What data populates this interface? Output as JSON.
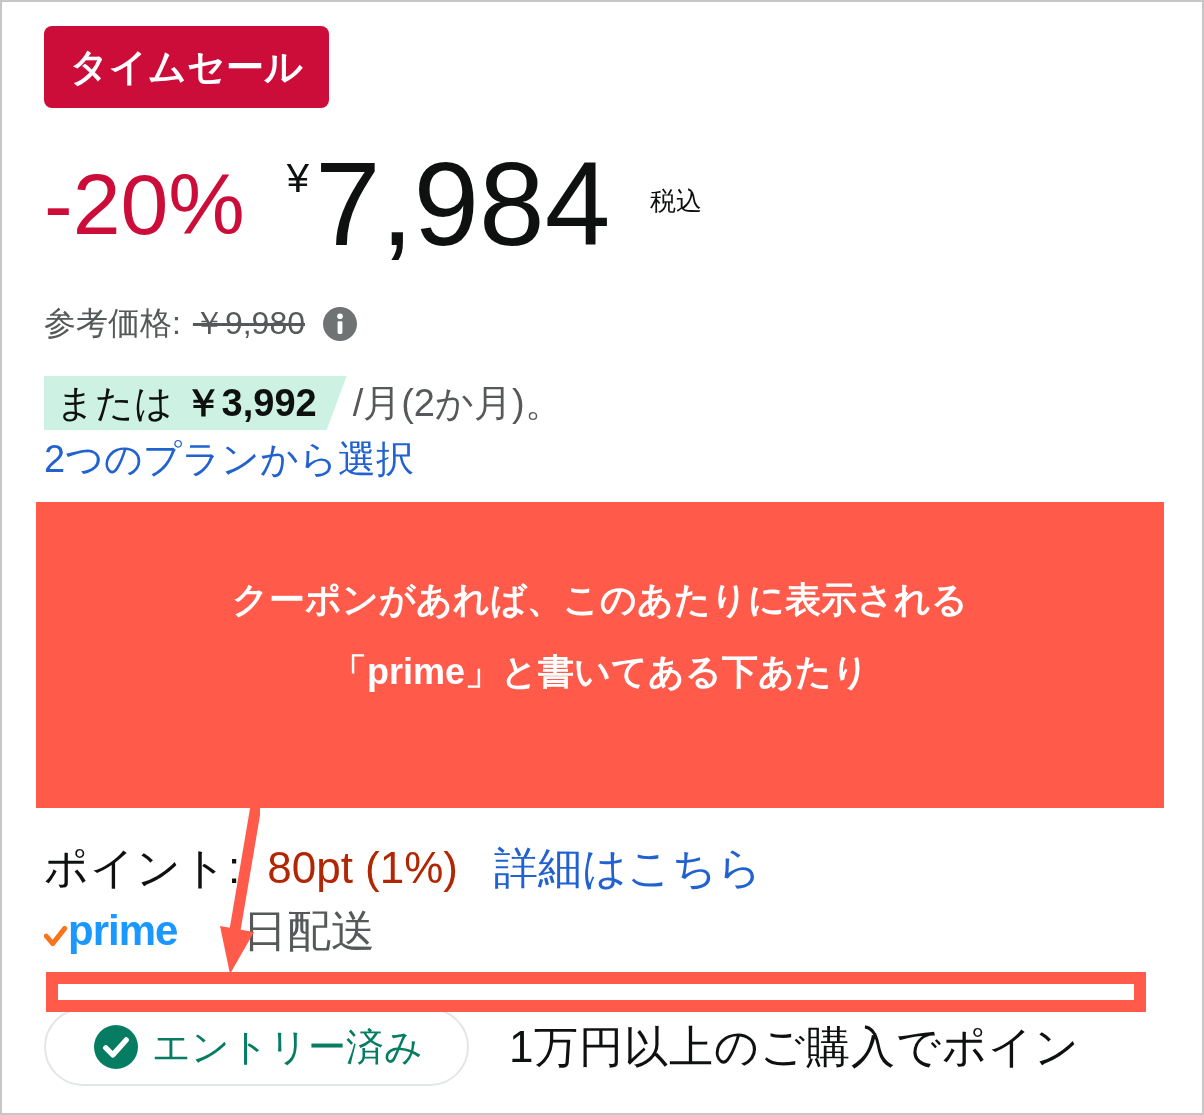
{
  "sale_badge": "タイムセール",
  "price": {
    "discount": "-20%",
    "currency": "¥",
    "amount": "7,984",
    "tax_note": "税込"
  },
  "reference_price": {
    "label": "参考価格:",
    "value": "￥9,980"
  },
  "installment": {
    "highlight": "または **￥3,992**",
    "suffix": "/月(2か月)。"
  },
  "plans_link": "2つのプランから選択",
  "annotation": {
    "lines": [
      "クーポンがあれば、このあたりに表示される",
      "「prime」と書いてある下あたり"
    ]
  },
  "points": {
    "label": "ポイント:",
    "value": "80pt (1%)",
    "details_link": "詳細はこちら"
  },
  "delivery": {
    "badge": "prime",
    "text": "日配送"
  },
  "entry": {
    "button": "エントリー済み",
    "checked": true,
    "description": "1万円以上のご購入でポイン"
  }
}
